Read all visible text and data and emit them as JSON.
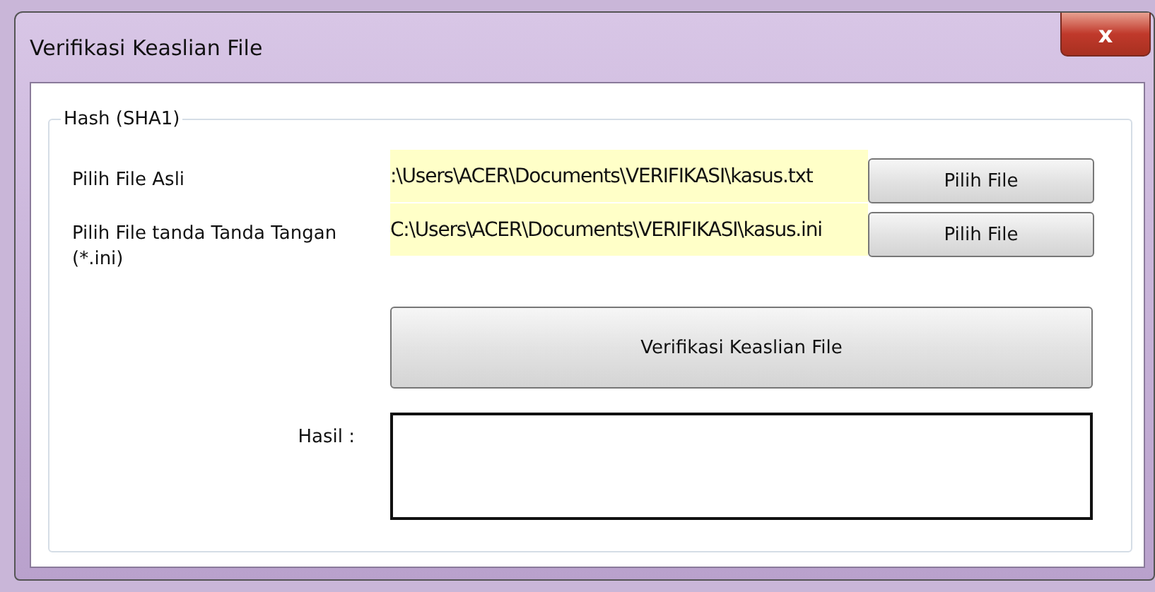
{
  "window": {
    "title": "Verifikasi Keaslian File",
    "close": "x"
  },
  "group": {
    "title": "Hash (SHA1)"
  },
  "rows": [
    {
      "label": "Pilih File Asli",
      "value": ":\\Users\\ACER\\Documents\\VERIFIKASI\\kasus.txt",
      "button": "Pilih File"
    },
    {
      "label": "Pilih File tanda Tanda Tangan (*.ini)",
      "value": "C:\\Users\\ACER\\Documents\\VERIFIKASI\\kasus.ini",
      "button": "Pilih File"
    }
  ],
  "verify_button": "Verifikasi Keaslian File",
  "result": {
    "label": "Hasil :"
  }
}
